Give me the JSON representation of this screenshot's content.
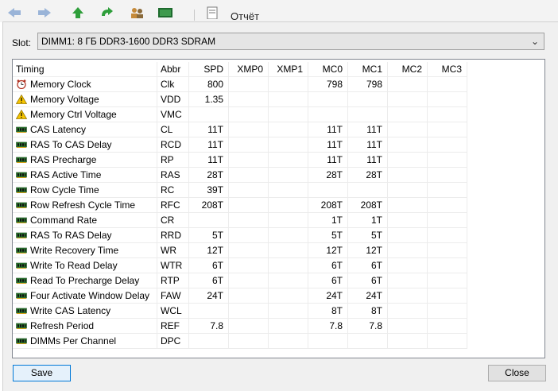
{
  "window": {
    "slot_label": "Slot:",
    "slot_value": "DIMM1: 8 ГБ DDR3-1600 DDR3 SDRAM",
    "toolbar_text": "Отчёт"
  },
  "table": {
    "columns": [
      "Timing",
      "Abbr",
      "SPD",
      "XMP0",
      "XMP1",
      "MC0",
      "MC1",
      "MC2",
      "MC3"
    ],
    "rows": [
      {
        "icon": "clock-icon",
        "name": "Memory Clock",
        "abbr": "Clk",
        "spd": "800",
        "xmp0": "",
        "xmp1": "",
        "mc0": "798",
        "mc1": "798",
        "mc2": "",
        "mc3": ""
      },
      {
        "icon": "warning-icon",
        "name": "Memory Voltage",
        "abbr": "VDD",
        "spd": "1.35",
        "xmp0": "",
        "xmp1": "",
        "mc0": "",
        "mc1": "",
        "mc2": "",
        "mc3": ""
      },
      {
        "icon": "warning-icon",
        "name": "Memory Ctrl Voltage",
        "abbr": "VMC",
        "spd": "",
        "xmp0": "",
        "xmp1": "",
        "mc0": "",
        "mc1": "",
        "mc2": "",
        "mc3": ""
      },
      {
        "icon": "ram-icon",
        "name": "CAS Latency",
        "abbr": "CL",
        "spd": "11T",
        "xmp0": "",
        "xmp1": "",
        "mc0": "11T",
        "mc1": "11T",
        "mc2": "",
        "mc3": ""
      },
      {
        "icon": "ram-icon",
        "name": "RAS To CAS Delay",
        "abbr": "RCD",
        "spd": "11T",
        "xmp0": "",
        "xmp1": "",
        "mc0": "11T",
        "mc1": "11T",
        "mc2": "",
        "mc3": ""
      },
      {
        "icon": "ram-icon",
        "name": "RAS Precharge",
        "abbr": "RP",
        "spd": "11T",
        "xmp0": "",
        "xmp1": "",
        "mc0": "11T",
        "mc1": "11T",
        "mc2": "",
        "mc3": ""
      },
      {
        "icon": "ram-icon",
        "name": "RAS Active Time",
        "abbr": "RAS",
        "spd": "28T",
        "xmp0": "",
        "xmp1": "",
        "mc0": "28T",
        "mc1": "28T",
        "mc2": "",
        "mc3": ""
      },
      {
        "icon": "ram-icon",
        "name": "Row Cycle Time",
        "abbr": "RC",
        "spd": "39T",
        "xmp0": "",
        "xmp1": "",
        "mc0": "",
        "mc1": "",
        "mc2": "",
        "mc3": ""
      },
      {
        "icon": "ram-icon",
        "name": "Row Refresh Cycle Time",
        "abbr": "RFC",
        "spd": "208T",
        "xmp0": "",
        "xmp1": "",
        "mc0": "208T",
        "mc1": "208T",
        "mc2": "",
        "mc3": ""
      },
      {
        "icon": "ram-icon",
        "name": "Command Rate",
        "abbr": "CR",
        "spd": "",
        "xmp0": "",
        "xmp1": "",
        "mc0": "1T",
        "mc1": "1T",
        "mc2": "",
        "mc3": ""
      },
      {
        "icon": "ram-icon",
        "name": "RAS To RAS Delay",
        "abbr": "RRD",
        "spd": "5T",
        "xmp0": "",
        "xmp1": "",
        "mc0": "5T",
        "mc1": "5T",
        "mc2": "",
        "mc3": ""
      },
      {
        "icon": "ram-icon",
        "name": "Write Recovery Time",
        "abbr": "WR",
        "spd": "12T",
        "xmp0": "",
        "xmp1": "",
        "mc0": "12T",
        "mc1": "12T",
        "mc2": "",
        "mc3": ""
      },
      {
        "icon": "ram-icon",
        "name": "Write To Read Delay",
        "abbr": "WTR",
        "spd": "6T",
        "xmp0": "",
        "xmp1": "",
        "mc0": "6T",
        "mc1": "6T",
        "mc2": "",
        "mc3": ""
      },
      {
        "icon": "ram-icon",
        "name": "Read To Precharge Delay",
        "abbr": "RTP",
        "spd": "6T",
        "xmp0": "",
        "xmp1": "",
        "mc0": "6T",
        "mc1": "6T",
        "mc2": "",
        "mc3": ""
      },
      {
        "icon": "ram-icon",
        "name": "Four Activate Window Delay",
        "abbr": "FAW",
        "spd": "24T",
        "xmp0": "",
        "xmp1": "",
        "mc0": "24T",
        "mc1": "24T",
        "mc2": "",
        "mc3": ""
      },
      {
        "icon": "ram-icon",
        "name": "Write CAS Latency",
        "abbr": "WCL",
        "spd": "",
        "xmp0": "",
        "xmp1": "",
        "mc0": "8T",
        "mc1": "8T",
        "mc2": "",
        "mc3": ""
      },
      {
        "icon": "ram-icon",
        "name": "Refresh Period",
        "abbr": "REF",
        "spd": "7.8",
        "xmp0": "",
        "xmp1": "",
        "mc0": "7.8",
        "mc1": "7.8",
        "mc2": "",
        "mc3": ""
      },
      {
        "icon": "ram-icon",
        "name": "DIMMs Per Channel",
        "abbr": "DPC",
        "spd": "",
        "xmp0": "",
        "xmp1": "",
        "mc0": "",
        "mc1": "",
        "mc2": "",
        "mc3": ""
      }
    ]
  },
  "buttons": {
    "save": "Save",
    "close": "Close"
  },
  "colors": {
    "accent": "#0078d7",
    "warning": "#f5c400",
    "ram_chip": "#2e7d32"
  }
}
